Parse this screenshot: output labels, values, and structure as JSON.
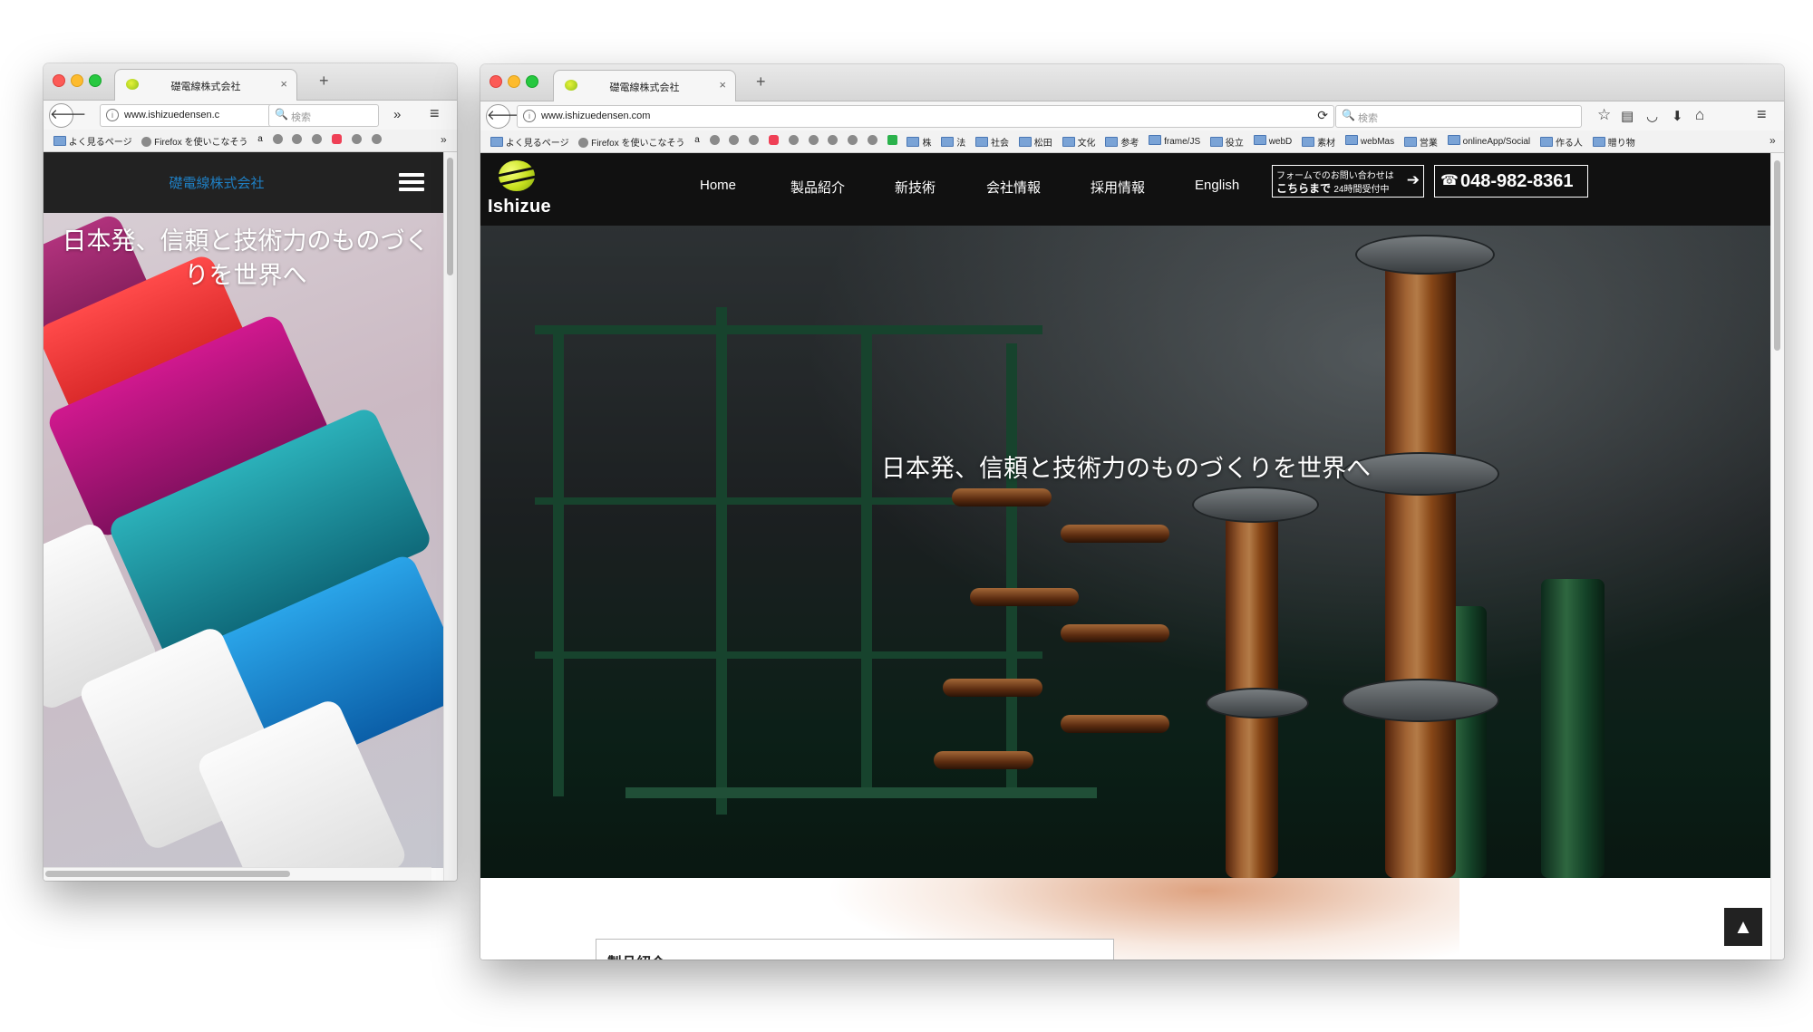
{
  "small_window": {
    "tab_title": "礎電線株式会社",
    "url": "www.ishizuedensen.c",
    "search_placeholder": "検索",
    "bookmarks": {
      "frequent": "よく見るページ",
      "firefox_guide": "Firefox を使いこなそう"
    },
    "site": {
      "brand": "礎電線株式会社",
      "hero_title": "日本発、信頼と技術力のものづくりを世界へ"
    }
  },
  "large_window": {
    "tab_title": "礎電線株式会社",
    "url": "www.ishizuedensen.com",
    "search_placeholder": "検索",
    "bookmarks": {
      "frequent": "よく見るページ",
      "firefox_guide": "Firefox を使いこなそう",
      "folders": [
        "株",
        "法",
        "社会",
        "松田",
        "文化",
        "参考",
        "frame/JS",
        "役立",
        "webD",
        "素材",
        "webMas",
        "営業",
        "onlineApp/Social",
        "作る人",
        "贈り物"
      ]
    },
    "site": {
      "logo_text": "Ishizue",
      "nav": [
        "Home",
        "製品紹介",
        "新技術",
        "会社情報",
        "採用情報",
        "English"
      ],
      "form_line1": "フォームでのお問い合わせは",
      "form_line2": "こちらまで",
      "form_line2_small": "24時間受付中",
      "form_arrow": "➔",
      "tel_icon": "☎",
      "tel": "048-982-8361",
      "hero_title": "日本発、信頼と技術力のものづくりを世界へ",
      "products_link": "製品紹介 »",
      "to_top": "▲"
    }
  },
  "icons": {
    "back": "🡐",
    "reload": "⟳",
    "search": "🔍",
    "overflow": "»",
    "menu": "≡",
    "star": "☆",
    "pocket": "◡",
    "download": "⬇",
    "home": "⌂",
    "close": "×",
    "plus": "+",
    "info": "i",
    "amazon": "a",
    "reading_list": "▤"
  }
}
